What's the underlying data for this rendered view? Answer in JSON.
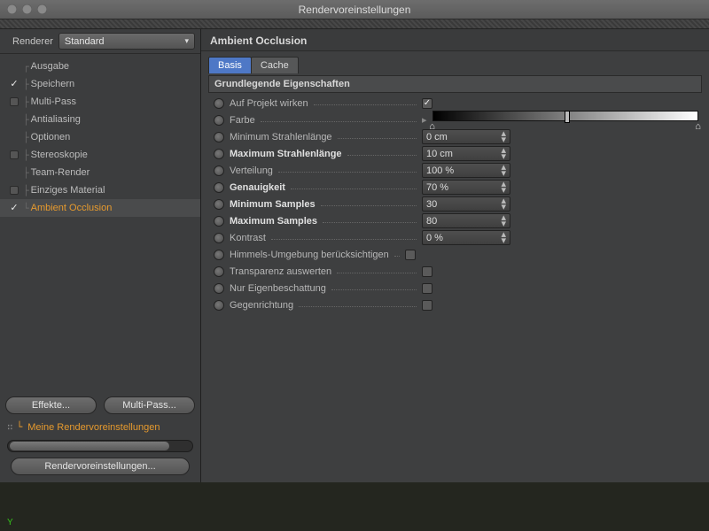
{
  "window": {
    "title": "Rendervoreinstellungen"
  },
  "renderer": {
    "label": "Renderer",
    "value": "Standard"
  },
  "tree": {
    "items": [
      {
        "label": "Ausgabe",
        "check": "none"
      },
      {
        "label": "Speichern",
        "check": "checked"
      },
      {
        "label": "Multi-Pass",
        "check": "box"
      },
      {
        "label": "Antialiasing",
        "check": "none"
      },
      {
        "label": "Optionen",
        "check": "none"
      },
      {
        "label": "Stereoskopie",
        "check": "box"
      },
      {
        "label": "Team-Render",
        "check": "none"
      },
      {
        "label": "Einziges Material",
        "check": "box"
      },
      {
        "label": "Ambient Occlusion",
        "check": "checked",
        "selected": true
      }
    ]
  },
  "buttons": {
    "effects": "Effekte...",
    "multipass": "Multi-Pass...",
    "presets_label": "Meine Rendervoreinstellungen",
    "open_settings": "Rendervoreinstellungen..."
  },
  "panel": {
    "title": "Ambient Occlusion",
    "tabs": {
      "basis": "Basis",
      "cache": "Cache"
    },
    "group_title": "Grundlegende Eigenschaften",
    "props": {
      "apply_project": {
        "label": "Auf Projekt wirken",
        "checked": true
      },
      "color": {
        "label": "Farbe"
      },
      "min_ray": {
        "label": "Minimum Strahlenlänge",
        "value": "0 cm"
      },
      "max_ray": {
        "label": "Maximum Strahlenlänge",
        "value": "10 cm",
        "bold": true
      },
      "distribution": {
        "label": "Verteilung",
        "value": "100 %"
      },
      "accuracy": {
        "label": "Genauigkeit",
        "value": "70 %",
        "bold": true
      },
      "min_samples": {
        "label": "Minimum Samples",
        "value": "30",
        "bold": true
      },
      "max_samples": {
        "label": "Maximum Samples",
        "value": "80",
        "bold": true
      },
      "contrast": {
        "label": "Kontrast",
        "value": "0 %"
      },
      "sky_env": {
        "label": "Himmels-Umgebung berücksichtigen",
        "checked": false
      },
      "transparency": {
        "label": "Transparenz auswerten",
        "checked": false
      },
      "self_shadow": {
        "label": "Nur Eigenbeschattung",
        "checked": false
      },
      "reverse": {
        "label": "Gegenrichtung",
        "checked": false
      }
    }
  },
  "viewport": {
    "axis": "Y"
  }
}
